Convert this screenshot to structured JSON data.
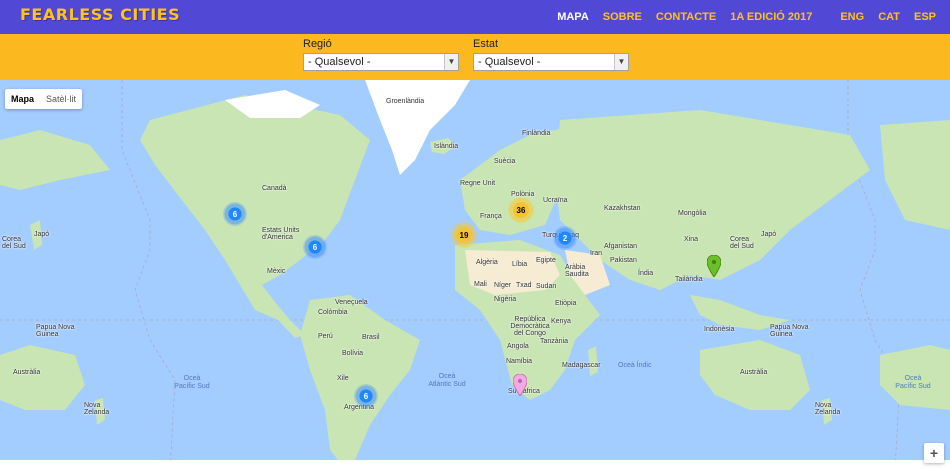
{
  "brand": {
    "logo_text": "FEARLESS CITIES"
  },
  "nav": {
    "items": [
      {
        "label": "MAPA",
        "active": true
      },
      {
        "label": "SOBRE",
        "active": false
      },
      {
        "label": "CONTACTE",
        "active": false
      },
      {
        "label": "1A EDICIÓ 2017",
        "active": false
      }
    ],
    "languages": [
      "ENG",
      "CAT",
      "ESP"
    ]
  },
  "filters": {
    "region": {
      "label": "Regió",
      "value": "- Qualsevol -"
    },
    "state": {
      "label": "Estat",
      "value": "- Qualsevol -"
    }
  },
  "map": {
    "type_buttons": [
      "Mapa",
      "Satèl·lit"
    ],
    "zoom_in": "+",
    "labels": {
      "groenlandia": "Groenlàndia",
      "islandia": "Islàndia",
      "finlandia": "Finlàndia",
      "suecia": "Suècia",
      "regne_unit": "Regne Unit",
      "polonia": "Polònia",
      "ucraina": "Ucraïna",
      "franca": "França",
      "kazakhstan": "Kazakhstan",
      "mongolia": "Mongòlia",
      "canada_left": "Canadà",
      "estats_units": "Estats Units d'America",
      "mexic": "Mèxic",
      "corea_left": "Corea del Sud",
      "japo_left": "Japó",
      "corea_right": "Corea del Sud",
      "japo_right": "Japó",
      "xina": "Xina",
      "turquia": "Turquia",
      "iraq": "Iraq",
      "afganistan": "Afganistan",
      "iran": "Iran",
      "pakistan": "Pakistan",
      "india": "Índia",
      "tailandia": "Tailàndia",
      "algeria": "Algèria",
      "libia": "Líbia",
      "egipte": "Egipte",
      "arabia": "Aràbia Saudita",
      "mali": "Mali",
      "niger": "Níger",
      "txad": "Txad",
      "sudan": "Sudan",
      "etiopia": "Etiòpia",
      "nigeria": "Nigèria",
      "kenya": "Kenya",
      "tanzania": "Tanzània",
      "rdc": "República Democràtica del Congo",
      "angola": "Angola",
      "namibia": "Namíbia",
      "madagascar": "Madagascar",
      "sud_africa": "Sud-àfrica",
      "indonesia": "Indonèsia",
      "png_left": "Papua Nova Guinea",
      "png_right": "Papua Nova Guinea",
      "australia_left": "Austràlia",
      "australia_right": "Austràlia",
      "nz_left": "Nova Zelanda",
      "nz_right": "Nova Zelanda",
      "veneçuela": "Veneçuela",
      "colombia": "Colòmbia",
      "peru": "Perú",
      "brasil": "Brasil",
      "bolivia": "Bolívia",
      "xile": "Xile",
      "argentina": "Argentina",
      "ocea_pacific_sud_1": "Oceà\nPacífic Sud",
      "ocea_atlantic_sud": "Oceà\nAtlàntic Sud",
      "ocea_indic": "Oceà Índic",
      "ocea_pacific_sud_2": "Oceà\nPacífic Sud"
    },
    "clusters": [
      {
        "count": "6",
        "color": "blue"
      },
      {
        "count": "6",
        "color": "blue"
      },
      {
        "count": "19",
        "color": "yellow"
      },
      {
        "count": "36",
        "color": "yellow"
      },
      {
        "count": "2",
        "color": "blue"
      },
      {
        "count": "6",
        "color": "blue"
      }
    ],
    "colors": {
      "water": "#a3ccff",
      "land": "#c9e5b3",
      "desert": "#f5ecd3",
      "ice": "#ffffff",
      "nav_bg": "#5149d6",
      "filter_bg": "#fbb81f",
      "accent": "#ffc21a"
    }
  }
}
